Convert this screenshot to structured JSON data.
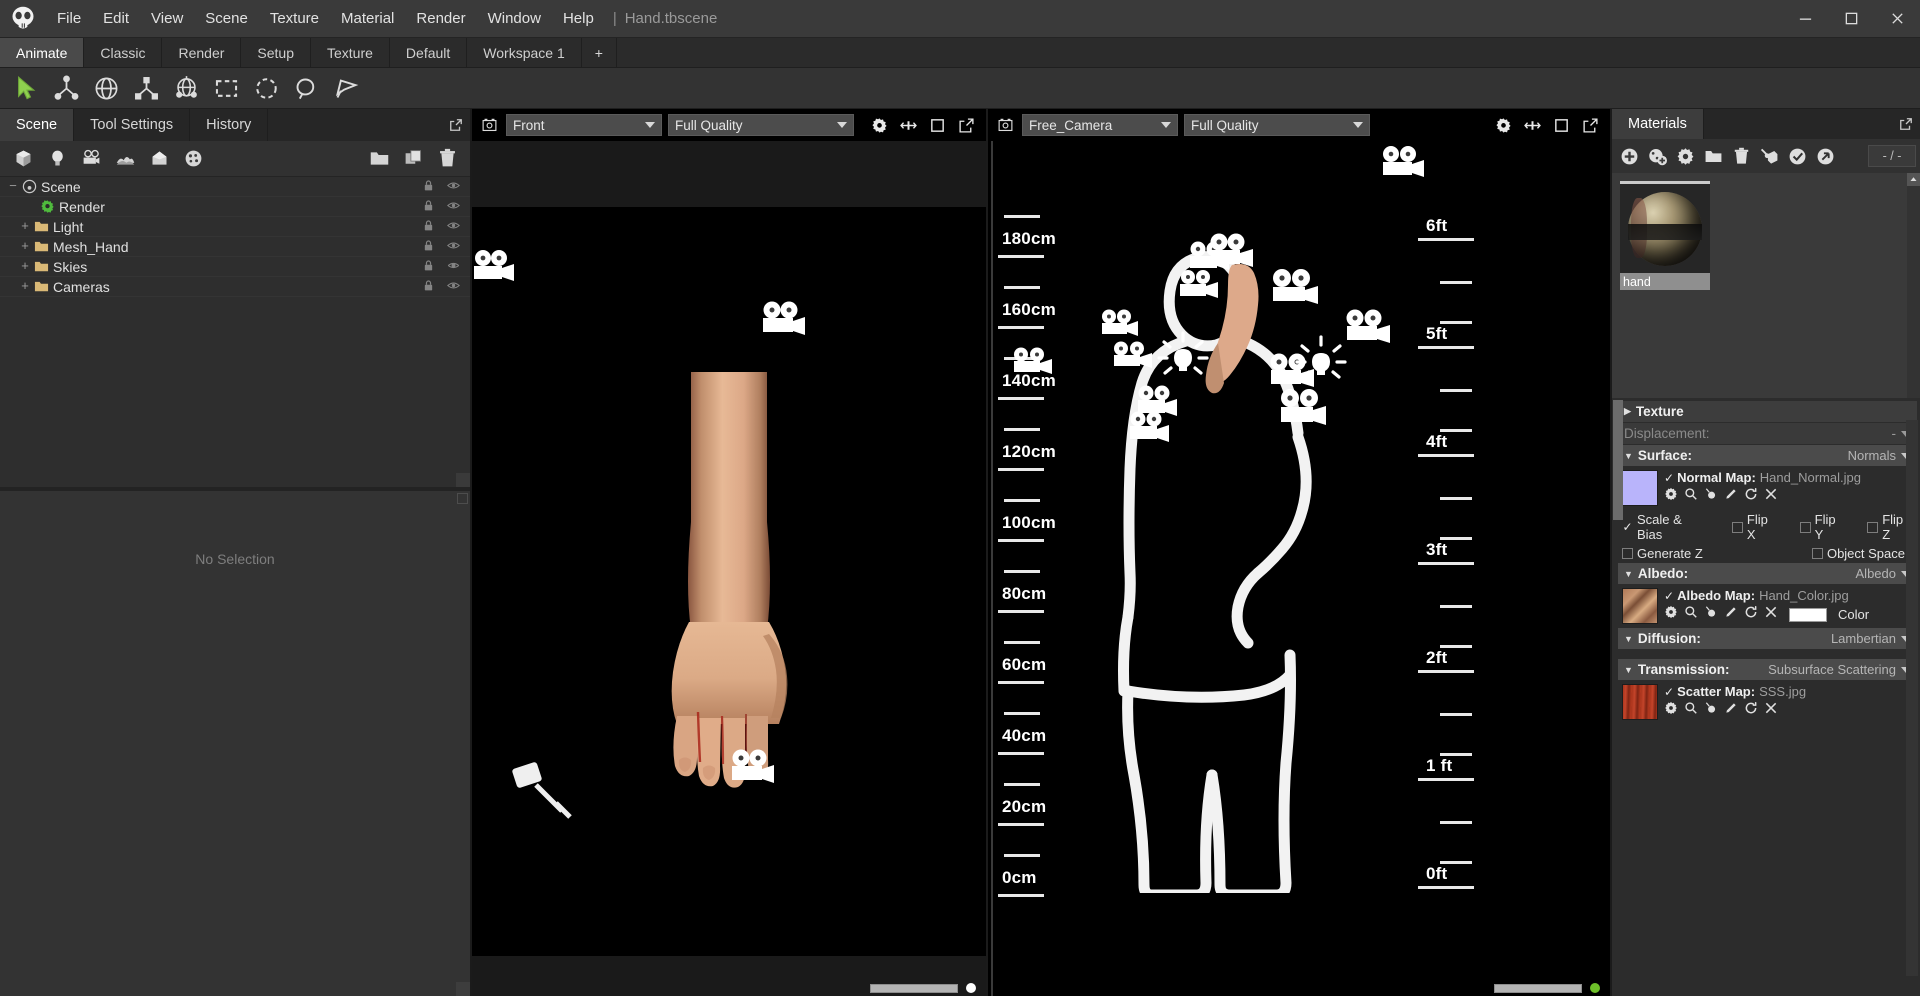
{
  "app": {
    "logo_icon": "marmoset-skull-logo",
    "document_title": "Hand.tbscene",
    "separator": "|"
  },
  "menubar": {
    "items": [
      {
        "label": "File"
      },
      {
        "label": "Edit"
      },
      {
        "label": "View"
      },
      {
        "label": "Scene"
      },
      {
        "label": "Texture"
      },
      {
        "label": "Material"
      },
      {
        "label": "Render"
      },
      {
        "label": "Window"
      },
      {
        "label": "Help"
      }
    ]
  },
  "window_controls": {
    "minimize": "minimize-icon",
    "maximize": "maximize-icon",
    "close": "close-icon"
  },
  "workspace_tabs": {
    "items": [
      {
        "label": "Animate",
        "active": true
      },
      {
        "label": "Classic",
        "active": false
      },
      {
        "label": "Render",
        "active": false
      },
      {
        "label": "Setup",
        "active": false
      },
      {
        "label": "Texture",
        "active": false
      },
      {
        "label": "Default",
        "active": false
      },
      {
        "label": "Workspace 1",
        "active": false
      }
    ],
    "add_label": "+"
  },
  "toolstrip": {
    "tools": [
      {
        "name": "select-arrow-tool",
        "active": true
      },
      {
        "name": "translate-tool",
        "active": false
      },
      {
        "name": "rotate-tool",
        "active": false
      },
      {
        "name": "scale-tool",
        "active": false
      },
      {
        "name": "transform-tool",
        "active": false
      },
      {
        "name": "rect-marquee-tool",
        "active": false
      },
      {
        "name": "ellipse-marquee-tool",
        "active": false
      },
      {
        "name": "lasso-tool",
        "active": false
      },
      {
        "name": "polygon-lasso-tool",
        "active": false
      }
    ]
  },
  "left_dock": {
    "tabs": [
      {
        "label": "Scene",
        "active": true
      },
      {
        "label": "Tool Settings",
        "active": false
      },
      {
        "label": "History",
        "active": false
      }
    ],
    "scene_toolbar": [
      {
        "name": "add-mesh-icon"
      },
      {
        "name": "add-light-icon"
      },
      {
        "name": "add-camera-icon"
      },
      {
        "name": "add-sky-icon"
      },
      {
        "name": "add-object-icon"
      },
      {
        "name": "add-material-icon"
      },
      {
        "name": "folder-icon"
      },
      {
        "name": "duplicate-icon"
      },
      {
        "name": "delete-icon"
      }
    ],
    "tree": [
      {
        "label": "Scene",
        "indent": 0,
        "expander": "−",
        "icon": "scene-icon",
        "locked": true,
        "visible": true
      },
      {
        "label": "Render",
        "indent": 1,
        "expander": "",
        "icon": "render-gear-icon",
        "locked": true,
        "visible": true
      },
      {
        "label": "Light",
        "indent": 1,
        "expander": "+",
        "icon": "folder-icon",
        "locked": true,
        "visible": true
      },
      {
        "label": "Mesh_Hand",
        "indent": 1,
        "expander": "+",
        "icon": "folder-icon",
        "locked": true,
        "visible": true
      },
      {
        "label": "Skies",
        "indent": 1,
        "expander": "+",
        "icon": "folder-icon",
        "locked": true,
        "visible": true
      },
      {
        "label": "Cameras",
        "indent": 1,
        "expander": "+",
        "icon": "folder-icon",
        "locked": true,
        "visible": true
      }
    ],
    "properties": {
      "empty_text": "No Selection"
    }
  },
  "viewports": [
    {
      "id": "left-viewport",
      "camera_icon": "camera-icon",
      "camera": "Front",
      "quality": "Full Quality",
      "header_icons": [
        "gear-icon",
        "move-icon",
        "frame-icon",
        "popout-icon"
      ],
      "record_dot_color": "#ffffff"
    },
    {
      "id": "right-viewport",
      "camera_icon": "camera-icon",
      "camera": "Free_Camera",
      "quality": "Full Quality",
      "header_icons": [
        "gear-icon",
        "move-icon",
        "frame-icon",
        "popout-icon"
      ],
      "record_dot_color": "#6ec02a"
    }
  ],
  "scale_reference": {
    "metric_unit": "cm",
    "metric_labels": [
      "180cm",
      "160cm",
      "140cm",
      "120cm",
      "100cm",
      "80cm",
      "60cm",
      "40cm",
      "20cm",
      "0cm"
    ],
    "imperial_unit": "ft",
    "imperial_labels": [
      "6ft",
      "5ft",
      "4ft",
      "3ft",
      "2ft",
      "1 ft",
      "0ft"
    ]
  },
  "right_dock": {
    "tabs": [
      {
        "label": "Materials",
        "active": true
      }
    ],
    "toolbar": [
      {
        "name": "add-material-icon"
      },
      {
        "name": "duplicate-material-icon"
      },
      {
        "name": "material-settings-icon"
      },
      {
        "name": "folder-icon"
      },
      {
        "name": "delete-icon"
      },
      {
        "name": "assign-material-icon"
      },
      {
        "name": "import-material-icon"
      },
      {
        "name": "export-material-icon"
      }
    ],
    "counter": "- / -",
    "materials": [
      {
        "name": "hand",
        "selected": true
      }
    ],
    "properties": {
      "sections": [
        {
          "key": "texture",
          "label": "Texture",
          "caret": "▶",
          "expanded": false,
          "value": "",
          "disabled": false
        },
        {
          "key": "displacement",
          "label": "Displacement:",
          "caret": "",
          "expanded": false,
          "value": "-",
          "disabled": true
        },
        {
          "key": "surface",
          "label": "Surface:",
          "caret": "▼",
          "expanded": true,
          "value": "Normals",
          "disabled": false,
          "map": {
            "checked": true,
            "label": "Normal Map:",
            "file": "Hand_Normal.jpg",
            "tile": "normal",
            "icons": [
              "gear-icon",
              "search-icon",
              "picker-icon",
              "edit-icon",
              "reload-icon",
              "remove-icon"
            ]
          },
          "checkboxes": [
            {
              "label": "Scale & Bias",
              "checked": true
            },
            {
              "label": "Flip X",
              "checked": false
            },
            {
              "label": "Flip Y",
              "checked": false
            },
            {
              "label": "Flip Z",
              "checked": false
            },
            {
              "label": "Generate Z",
              "checked": false
            },
            {
              "label": "Object Space",
              "checked": false
            }
          ]
        },
        {
          "key": "albedo",
          "label": "Albedo:",
          "caret": "▼",
          "expanded": true,
          "value": "Albedo",
          "disabled": false,
          "map": {
            "checked": true,
            "label": "Albedo Map:",
            "file": "Hand_Color.jpg",
            "tile": "albedo",
            "icons": [
              "gear-icon",
              "search-icon",
              "picker-icon",
              "edit-icon",
              "reload-icon",
              "remove-icon"
            ],
            "color_label": "Color",
            "color_value": "#ffffff"
          }
        },
        {
          "key": "diffusion",
          "label": "Diffusion:",
          "caret": "▼",
          "expanded": true,
          "value": "Lambertian",
          "disabled": false
        },
        {
          "key": "transmission",
          "label": "Transmission:",
          "caret": "▼",
          "expanded": true,
          "value": "Subsurface Scattering",
          "disabled": false,
          "map": {
            "checked": true,
            "label": "Scatter Map:",
            "file": "SSS.jpg",
            "tile": "sss",
            "icons": [
              "gear-icon",
              "search-icon",
              "picker-icon",
              "edit-icon",
              "reload-icon",
              "remove-icon"
            ]
          }
        }
      ]
    }
  }
}
